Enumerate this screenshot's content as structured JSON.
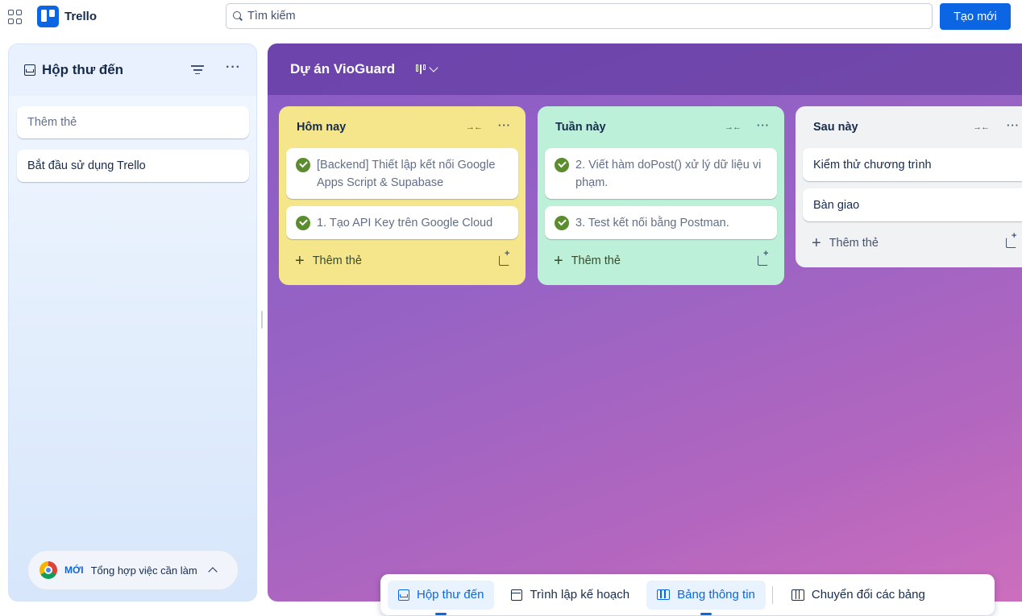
{
  "topbar": {
    "app_name": "Trello",
    "search_placeholder": "Tìm kiếm",
    "create_label": "Tạo mới",
    "accent": "#0c66e4"
  },
  "inbox": {
    "title": "Hộp thư đến",
    "add_card_placeholder": "Thêm thẻ",
    "cards": [
      "Bắt đầu sử dụng Trello"
    ],
    "todo_badge": "MỚI",
    "todo_label": "Tổng hợp việc cần làm"
  },
  "board": {
    "title": "Dự án VioGuard",
    "lists": [
      {
        "title": "Hôm nay",
        "color": "#f5e68c",
        "cards": [
          {
            "text": "[Backend] Thiết lập kết nối Google Apps Script & Supabase",
            "done": true
          },
          {
            "text": "1. Tạo API Key trên Google Cloud",
            "done": true
          }
        ],
        "add_label": "Thêm thẻ"
      },
      {
        "title": "Tuần này",
        "color": "#bdf0d9",
        "cards": [
          {
            "text": "2. Viết hàm doPost() xử lý dữ liệu vi phạm.",
            "done": true
          },
          {
            "text": "3. Test kết nối bằng Postman.",
            "done": true
          }
        ],
        "add_label": "Thêm thẻ"
      },
      {
        "title": "Sau này",
        "color": "#f1f2f4",
        "cards": [
          {
            "text": "Kiểm thử chương trình",
            "done": false
          },
          {
            "text": "Bàn giao",
            "done": false
          }
        ],
        "add_label": "Thêm thẻ"
      }
    ]
  },
  "bottom_nav": {
    "items": [
      {
        "label": "Hộp thư đến",
        "icon": "inbox-icon",
        "active": true
      },
      {
        "label": "Trình lập kế hoạch",
        "icon": "calendar-icon",
        "active": false
      },
      {
        "label": "Bảng thông tin",
        "icon": "board-icon",
        "active": true
      },
      {
        "label": "Chuyển đổi các bảng",
        "icon": "switch-boards-icon",
        "active": false
      }
    ]
  }
}
